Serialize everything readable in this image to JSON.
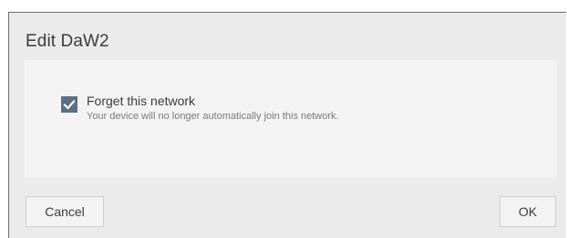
{
  "dialog": {
    "title": "Edit DaW2",
    "option": {
      "label": "Forget this network",
      "description": "Your device will no longer automatically join this network.",
      "checked": true,
      "checkbox_color": "#5e6f85"
    },
    "buttons": {
      "cancel_label": "Cancel",
      "ok_label": "OK"
    }
  }
}
